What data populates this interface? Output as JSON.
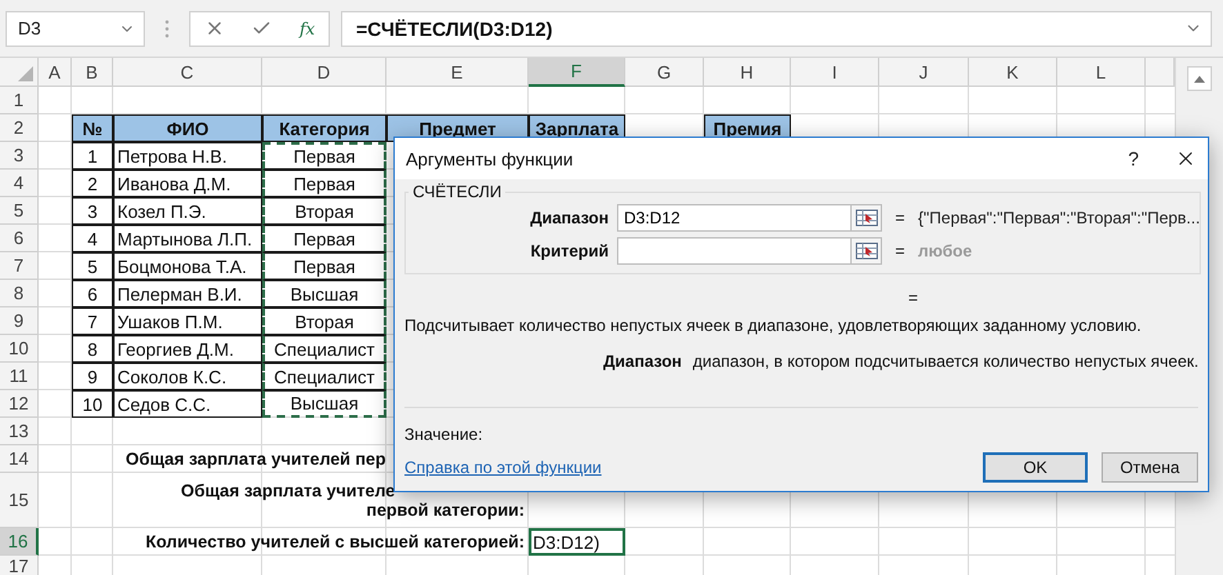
{
  "formula_bar": {
    "name_box": "D3",
    "function_label": "fx",
    "formula": "=СЧЁТЕСЛИ(D3:D12)"
  },
  "sheet": {
    "columns": [
      {
        "label": "A",
        "selected": false
      },
      {
        "label": "B",
        "selected": false
      },
      {
        "label": "C",
        "selected": false
      },
      {
        "label": "D",
        "selected": false
      },
      {
        "label": "E",
        "selected": false
      },
      {
        "label": "F",
        "selected": true
      },
      {
        "label": "G",
        "selected": false
      },
      {
        "label": "H",
        "selected": false
      },
      {
        "label": "I",
        "selected": false
      },
      {
        "label": "J",
        "selected": false
      },
      {
        "label": "K",
        "selected": false
      },
      {
        "label": "L",
        "selected": false
      }
    ],
    "rows": [
      {
        "label": "1",
        "selected": false
      },
      {
        "label": "2",
        "selected": false
      },
      {
        "label": "3",
        "selected": false
      },
      {
        "label": "4",
        "selected": false
      },
      {
        "label": "5",
        "selected": false
      },
      {
        "label": "6",
        "selected": false
      },
      {
        "label": "7",
        "selected": false
      },
      {
        "label": "8",
        "selected": false
      },
      {
        "label": "9",
        "selected": false
      },
      {
        "label": "10",
        "selected": false
      },
      {
        "label": "11",
        "selected": false
      },
      {
        "label": "12",
        "selected": false
      },
      {
        "label": "13",
        "selected": false
      },
      {
        "label": "14",
        "selected": false
      },
      {
        "label": "15",
        "selected": false
      },
      {
        "label": "16",
        "selected": true
      },
      {
        "label": "17",
        "selected": false
      }
    ],
    "table": {
      "columns": [
        "№",
        "ФИО",
        "Категория",
        "Предмет",
        "Зарплата"
      ],
      "rows": [
        {
          "number": "1",
          "name": "Петрова Н.В.",
          "category": "Первая"
        },
        {
          "number": "2",
          "name": "Иванова Д.М.",
          "category": "Первая"
        },
        {
          "number": "3",
          "name": "Козел П.Э.",
          "category": "Вторая"
        },
        {
          "number": "4",
          "name": "Мартынова Л.П.",
          "category": "Первая"
        },
        {
          "number": "5",
          "name": "Боцмонова Т.А.",
          "category": "Первая"
        },
        {
          "number": "6",
          "name": "Пелерман В.И.",
          "category": "Высшая"
        },
        {
          "number": "7",
          "name": "Ушаков П.М.",
          "category": "Вторая"
        },
        {
          "number": "8",
          "name": "Георгиев Д.М.",
          "category": "Специалист"
        },
        {
          "number": "9",
          "name": "Соколов К.С.",
          "category": "Специалист"
        },
        {
          "number": "10",
          "name": "Седов С.С.",
          "category": "Высшая"
        }
      ]
    },
    "bonus_header": "Премия",
    "summary": [
      {
        "lines": [
          "Общая зарплата учителей пер"
        ]
      },
      {
        "lines": [
          "Общая зарплата учителе",
          "первой категории:"
        ]
      },
      {
        "lines": [
          "Количество учителей с высшей категорией:"
        ],
        "value": "D3:D12)"
      }
    ]
  },
  "dialog": {
    "title": "Аргументы функции",
    "help": "?",
    "function_name": "СЧЁТЕСЛИ",
    "arguments": [
      {
        "label": "Диапазон",
        "value": "D3:D12",
        "sign": "=",
        "result": "{\"Первая\":\"Первая\":\"Вторая\":\"Перв...",
        "result_greyed": false
      },
      {
        "label": "Критерий",
        "sign": "=",
        "result": "любое",
        "result_greyed": true
      }
    ],
    "formula_result": "=",
    "description": "Подсчитывает количество непустых ячеек в диапазоне, удовлетворяющих заданному условию.",
    "argument_help": {
      "name": "Диапазон",
      "text": "диапазон, в котором подсчитывается количество непустых ячеек."
    },
    "value_label": "Значение:",
    "help_link": "Справка по этой функции",
    "buttons": [
      {
        "label": "OK",
        "default": true
      },
      {
        "label": "Отмена",
        "default": false
      }
    ]
  }
}
